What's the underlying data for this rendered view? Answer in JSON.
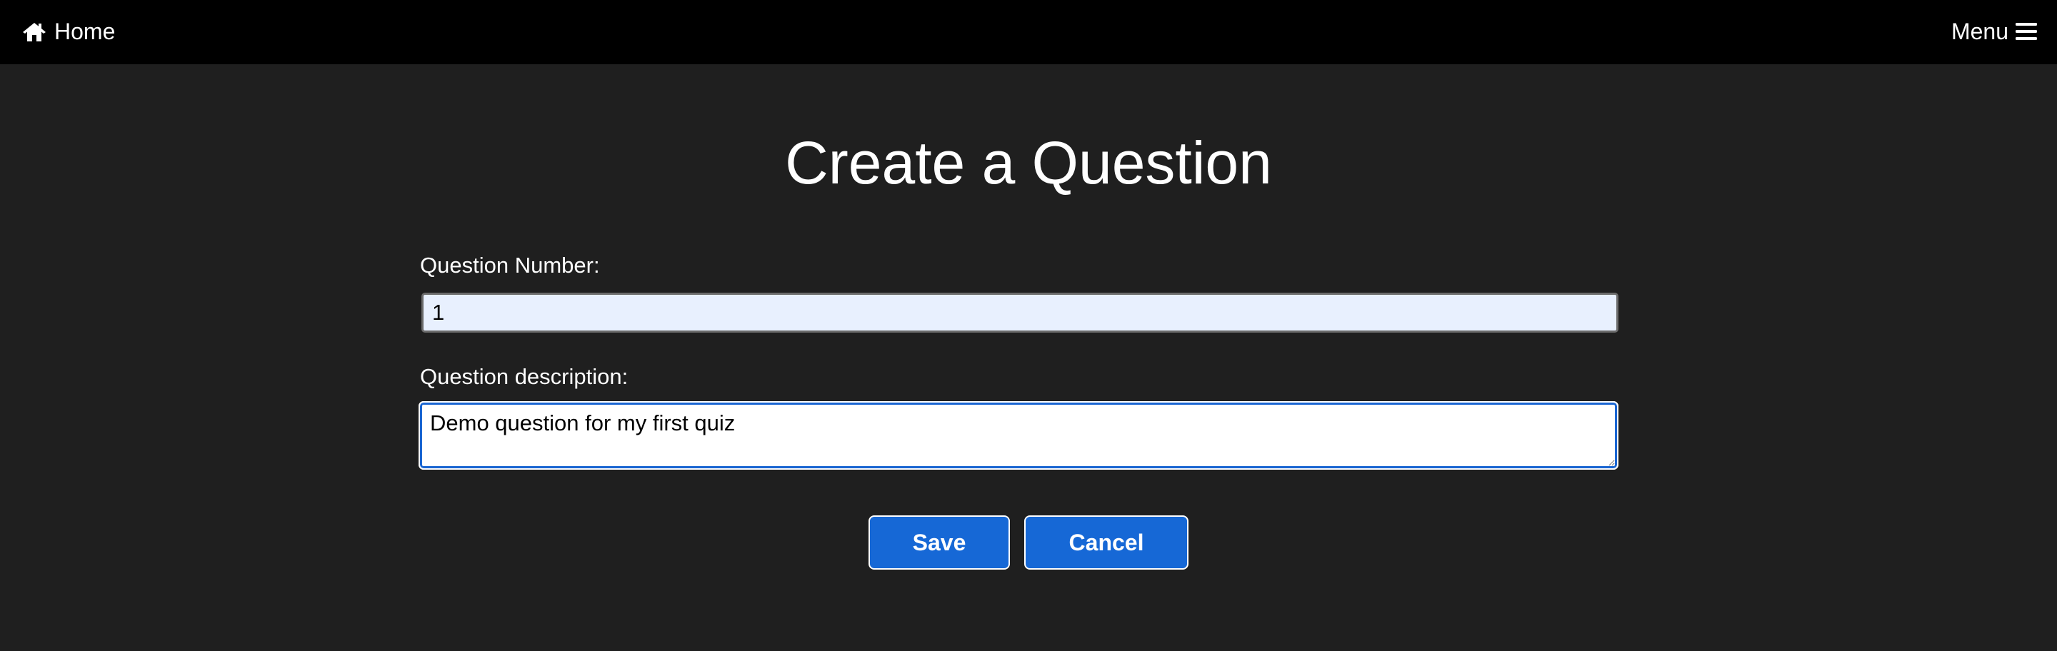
{
  "nav": {
    "home_icon": "home-icon",
    "home_label": "Home",
    "menu_label": "Menu",
    "menu_icon": "hamburger-icon"
  },
  "page": {
    "title": "Create a Question"
  },
  "form": {
    "number_label": "Question Number:",
    "number_value": "1",
    "description_label": "Question description:",
    "description_value": "Demo question for my first quiz"
  },
  "actions": {
    "save_label": "Save",
    "cancel_label": "Cancel"
  },
  "colors": {
    "topbar": "#000000",
    "background": "#1f1f1f",
    "button": "#1668d6",
    "input_autofill": "#e8f0fe",
    "focus_border": "#1a66d2"
  }
}
